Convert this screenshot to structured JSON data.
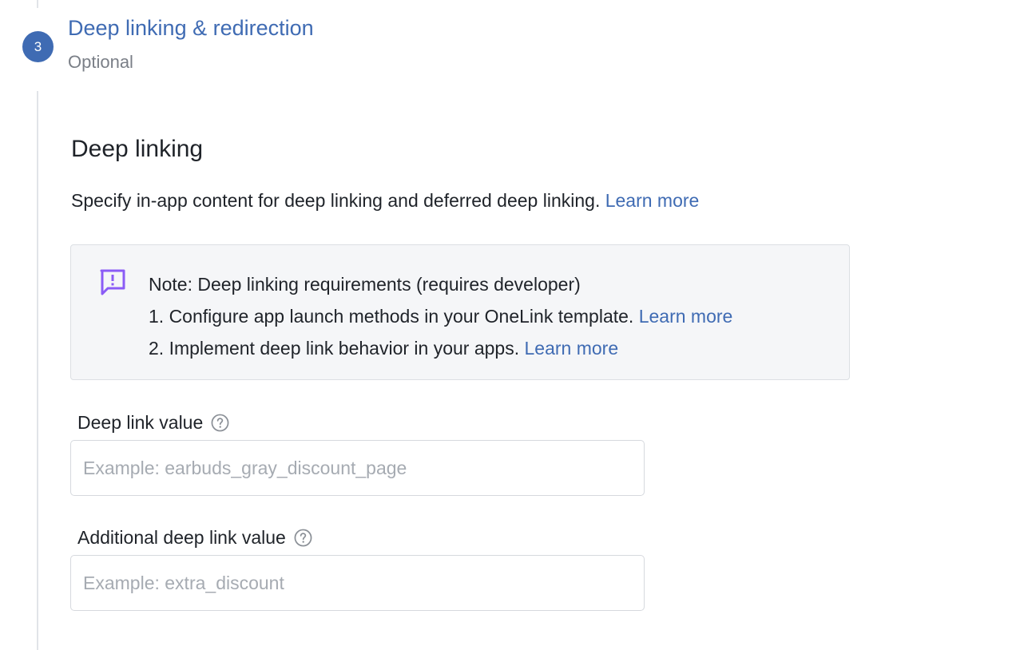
{
  "step": {
    "number": "3",
    "title": "Deep linking & redirection",
    "subtitle": "Optional"
  },
  "section": {
    "title": "Deep linking",
    "description": "Specify in-app content for deep linking and deferred deep linking.",
    "learn_more": "Learn more"
  },
  "note": {
    "icon": "message-alert-icon",
    "label": "Note:",
    "heading": "Deep linking requirements (requires developer)",
    "items": [
      {
        "text": "1. Configure app launch methods in your OneLink template.",
        "link": "Learn more"
      },
      {
        "text": "2. Implement deep link behavior in your apps.",
        "link": "Learn more"
      }
    ]
  },
  "fields": {
    "deep_link": {
      "label": "Deep link value",
      "placeholder": "Example: earbuds_gray_discount_page",
      "value": ""
    },
    "additional_deep_link": {
      "label": "Additional deep link value",
      "placeholder": "Example: extra_discount",
      "value": ""
    }
  },
  "colors": {
    "accent": "#3f6bb3",
    "note_icon": "#8b5cf6",
    "note_background": "#f5f6f8"
  }
}
